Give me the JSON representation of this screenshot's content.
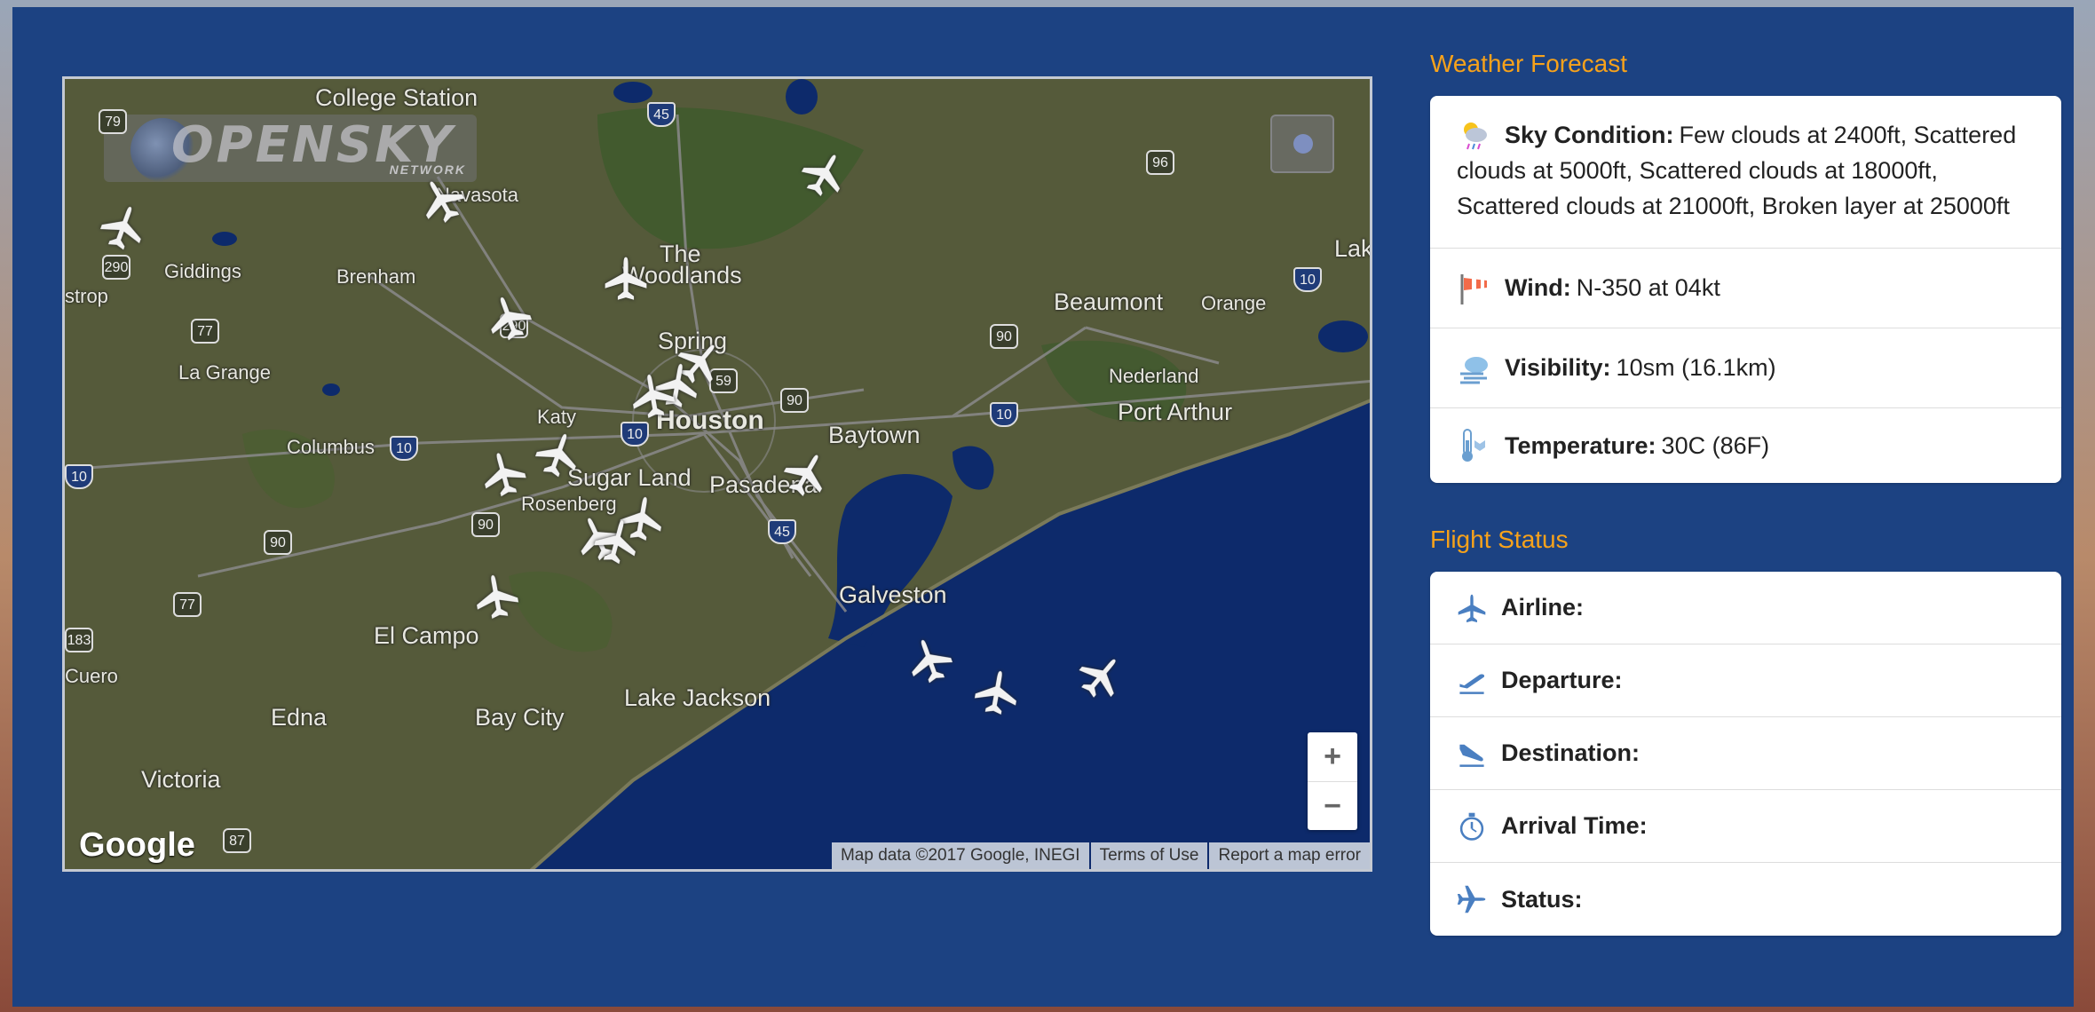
{
  "map": {
    "places": [
      "College Station",
      "Navasota",
      "Giddings",
      "Brenham",
      "The",
      "Woodlands",
      "Spring",
      "Beaumont",
      "Orange",
      "Lake",
      "La Grange",
      "Nederland",
      "Port Arthur",
      "Katy",
      "Houston",
      "Baytown",
      "Columbus",
      "Sugar Land",
      "Pasadena",
      "Rosenberg",
      "strop",
      "Galveston",
      "El Campo",
      "Lake Jackson",
      "Edna",
      "Bay City",
      "Victoria",
      "Cuero"
    ],
    "shields": [
      "79",
      "45",
      "96",
      "290",
      "290",
      "77",
      "10",
      "90",
      "10",
      "10",
      "90",
      "10",
      "90",
      "45",
      "90",
      "77",
      "183",
      "87",
      "59"
    ],
    "osn_title": "OPENSKY",
    "osn_subtitle": "NETWORK",
    "zoom_in": "+",
    "zoom_out": "−",
    "google": "Google",
    "attribution": [
      "Map data ©2017 Google, INEGI",
      "Terms of Use",
      "Report a map error"
    ]
  },
  "weather": {
    "header": "Weather Forecast",
    "sky_label": "Sky Condition:",
    "sky_value": "Few clouds at 2400ft, Scattered clouds at 5000ft, Scattered clouds at 18000ft, Scattered clouds at 21000ft, Broken layer at 25000ft",
    "wind_label": "Wind:",
    "wind_value": "N-350 at 04kt",
    "vis_label": "Visibility:",
    "vis_value": "10sm (16.1km)",
    "temp_label": "Temperature:",
    "temp_value": "30C (86F)"
  },
  "flight": {
    "header": "Flight Status",
    "airline_label": "Airline:",
    "departure_label": "Departure:",
    "destination_label": "Destination:",
    "arrival_label": "Arrival Time:",
    "status_label": "Status:"
  },
  "colors": {
    "background": "#1c4282",
    "accent": "#f7a21b",
    "water": "#0d2a6b",
    "land": "#555a3a"
  }
}
